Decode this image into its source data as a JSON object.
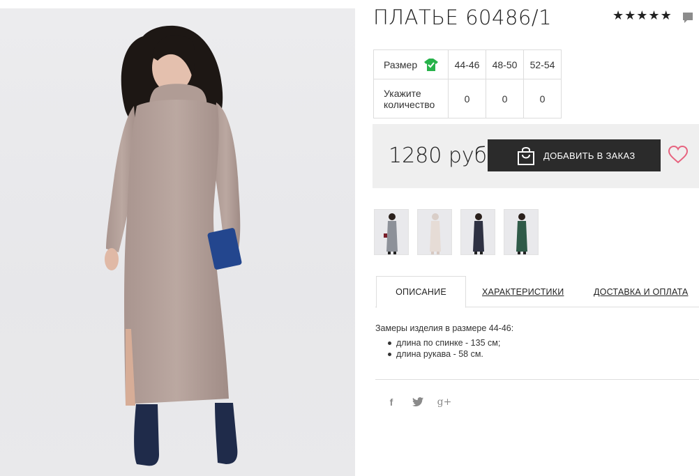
{
  "product": {
    "title": "ПЛАТЬЕ 60486/1",
    "rating_stars": 5,
    "rating_icon": "star-icon"
  },
  "size_table": {
    "size_label": "Размер",
    "qty_label_line1": "Укажите",
    "qty_label_line2": "количество",
    "sizes": [
      "44-46",
      "48-50",
      "52-54"
    ],
    "quantities": [
      "0",
      "0",
      "0"
    ]
  },
  "price": {
    "value": "1280 руб",
    "add_button": "ДОБАВИТЬ В ЗАКАЗ"
  },
  "thumbnails": [
    {
      "name": "thumb-grey",
      "color": "#8d9199"
    },
    {
      "name": "thumb-beige",
      "color": "#e6dcd6"
    },
    {
      "name": "thumb-navy",
      "color": "#2e3142"
    },
    {
      "name": "thumb-green",
      "color": "#2f5a48"
    }
  ],
  "tabs": [
    {
      "label": "ОПИСАНИЕ",
      "active": true
    },
    {
      "label": "ХАРАКТЕРИСТИКИ",
      "active": false
    },
    {
      "label": "ДОСТАВКА И ОПЛАТА",
      "active": false
    }
  ],
  "description": {
    "intro": "Замеры изделия в размере 44-46:",
    "items": [
      "длина по спинке - 135 см;",
      "длина рукава - 58 см."
    ]
  },
  "social": {
    "facebook": "f",
    "twitter": "twitter-icon",
    "google": "g+"
  },
  "colors": {
    "dress": "#b7a39c",
    "button": "#2b2b2b",
    "heart": "#e7637f",
    "size_check": "#27b24a"
  }
}
